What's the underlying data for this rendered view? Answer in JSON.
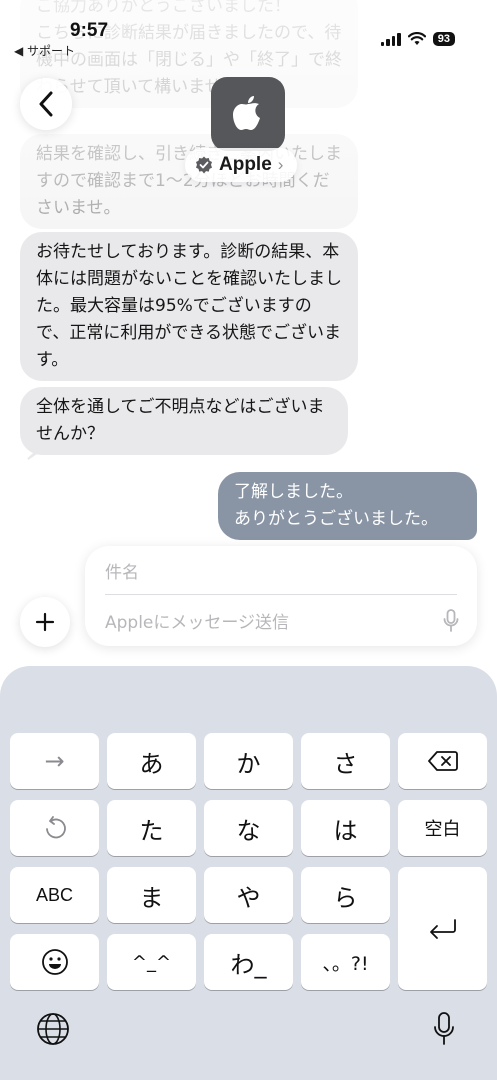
{
  "status_bar": {
    "time": "9:57",
    "back_label": "◀ サポート",
    "battery": "93"
  },
  "header": {
    "contact_name": "Apple",
    "back_icon": "chevron-left-icon",
    "verified_icon": "verified-badge-icon"
  },
  "messages": [
    {
      "direction": "in",
      "text": "ご協力ありがとうございました！\nこちらに診断結果が届きましたので、待機中の画面は「閉じる」や「終了」で終わらせて頂いて構いません。",
      "faded": true
    },
    {
      "direction": "in",
      "text": "結果を確認し、引き続きご案内いたしますので確認まで1〜2分ほどお時間くださいませ。",
      "faded": true
    },
    {
      "direction": "in",
      "text": "お待たせしております。診断の結果、本体には問題がないことを確認いたしました。最大容量は95%でございますので、正常に利用ができる状態でございます。"
    },
    {
      "direction": "in",
      "text": "全体を通してご不明点などはございませんか？"
    },
    {
      "direction": "out",
      "text": "了解しました。\nありがとうございました。"
    }
  ],
  "compose": {
    "subject_placeholder": "件名",
    "message_placeholder": "Appleにメッセージ送信",
    "plus_label": "+"
  },
  "keyboard": {
    "rows": [
      [
        "→",
        "あ",
        "か",
        "さ",
        "delete"
      ],
      [
        "undo",
        "た",
        "な",
        "は",
        "空白"
      ],
      [
        "ABC",
        "ま",
        "や",
        "ら",
        "return"
      ],
      [
        "emoji",
        "^_^",
        "わ_",
        "、。?!"
      ]
    ],
    "keys": {
      "arrow": "→",
      "a": "あ",
      "ka": "か",
      "sa": "さ",
      "ta": "た",
      "na": "な",
      "ha": "は",
      "space": "空白",
      "abc": "ABC",
      "ma": "ま",
      "ya": "や",
      "ra": "ら",
      "kaomoji": "^_^",
      "wa": "わ_",
      "punct": "、。?!"
    }
  },
  "colors": {
    "incoming_bubble": "#e9e9eb",
    "outgoing_bubble": "#8995a5",
    "keyboard_bg": "#dadee7",
    "avatar_bg": "#56575b"
  }
}
